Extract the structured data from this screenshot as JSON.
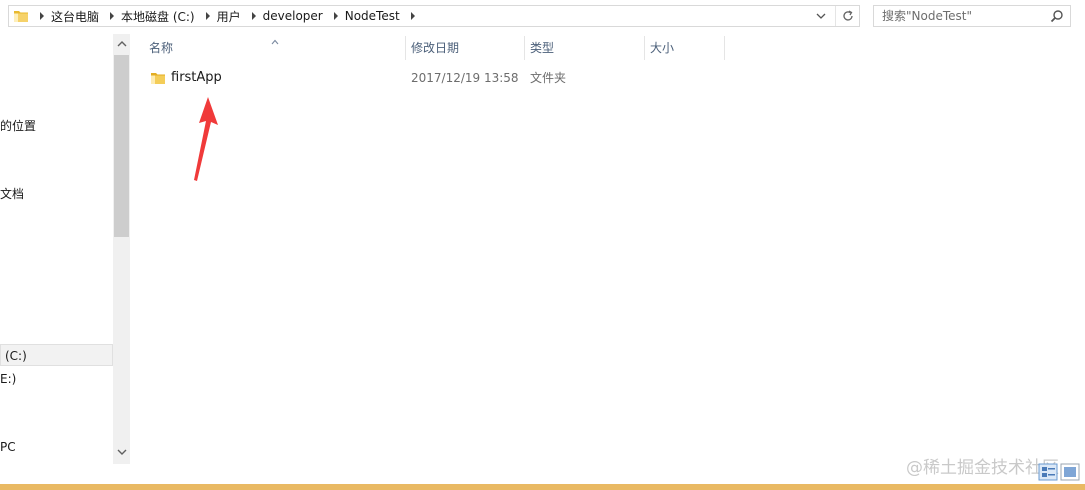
{
  "address_bar": {
    "breadcrumbs": [
      "这台电脑",
      "本地磁盘 (C:)",
      "用户",
      "developer",
      "NodeTest"
    ]
  },
  "search": {
    "placeholder": "搜索\"NodeTest\""
  },
  "nav": {
    "items": [
      "的位置",
      "文档",
      "(C:)",
      "E:)",
      "PC"
    ],
    "selected_index": 2
  },
  "columns": {
    "name": "名称",
    "modified": "修改日期",
    "type": "类型",
    "size": "大小"
  },
  "files": [
    {
      "name": "firstApp",
      "modified": "2017/12/19 13:58",
      "type": "文件夹",
      "size": ""
    }
  ],
  "watermark": "@稀土掘金技术社区",
  "colors": {
    "folder": "#f0c030",
    "accent_bar": "#e9b963",
    "annotation_arrow": "#f03a3a"
  }
}
